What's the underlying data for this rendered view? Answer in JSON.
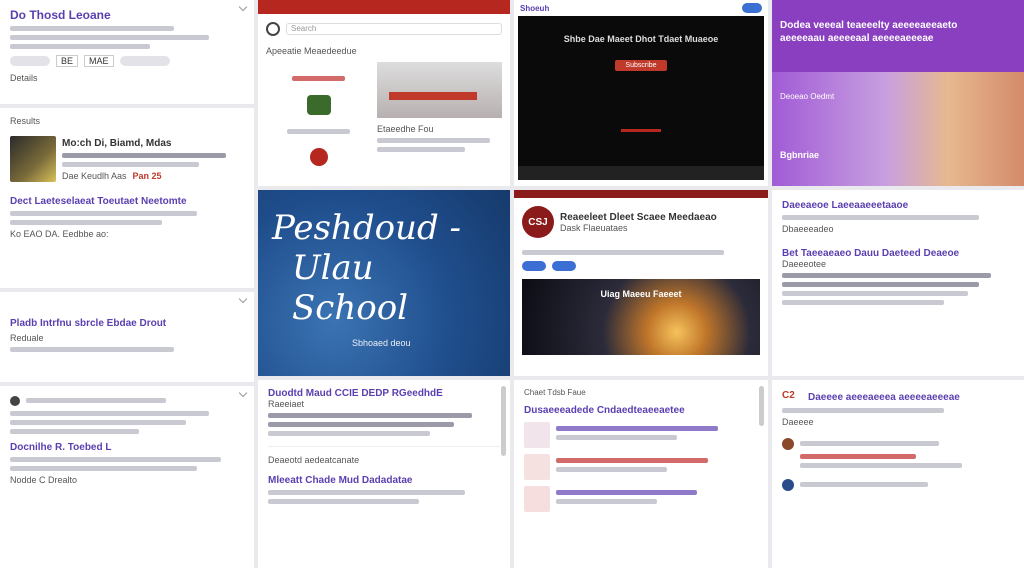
{
  "col1": {
    "header": "Do Thosd Leoane",
    "tags": [
      "BE",
      "MAE"
    ],
    "more_label": "Details",
    "feed_label": "Results",
    "item_title": "Mo:ch Di, Biamd, Mdas",
    "item_sub": "Dae Keudlh Aas",
    "item_meta": "Pan 25",
    "section_title": "Dect Laeteselaeat Toeutaet Neetomte",
    "section_meta": "Ko EAO DA. Eedbbe ao:",
    "section2_title": "Pladb Intrfnu sbrcle Ebdae Drout",
    "section2_sub": "Reduale",
    "section3_title": "Docnilhe R. Toebed L",
    "section3_meta": "Nodde C Drealto"
  },
  "col2": {
    "search_placeholder": "Search",
    "feed_title": "Apeeatie Meaedeedue",
    "card_caption": "Etaeedhe Fou",
    "hero_line1": "Peshdoud -",
    "hero_line2": "Ulau School",
    "hero_sub": "Sbhoaed deou",
    "card2_title": "Duodtd Maud CCIE DEDP RGeedhdE",
    "card2_sub": "Raeeiaet",
    "card3_header": "Deaeotd aedeatcanate",
    "card3_title": "Mleeatt Chade Mud Dadadatae"
  },
  "col3": {
    "tab_label": "Shoeuh",
    "banner_title": "Shbe Dae Maeet Dhot Tdaet Muaeoe",
    "banner_cta": "Subscribe",
    "promo_badge": "CSJ",
    "promo_title": "Reaeeleet Dleet Scaee Meedaeao",
    "promo_sub": "Dask Flaeuataes",
    "sky_caption": "Uiag Maeeu Faeeet",
    "list_header": "Chaet Tdsb Faue",
    "list_title": "Dusaeeeadede Cndaedteaeeaetee"
  },
  "col4": {
    "banner_line1": "Dodea veeeal teaeeelty aeeeeaeeaeto",
    "banner_line2": "aeeeeaau aeeeeaal aeeeeaeeeae",
    "banner_side": "Deoeao Oedmt",
    "banner_footer": "Bgbnriae",
    "card_title": "Daeeaeoe Laeeaaeeetaaoe",
    "card_sub": "Dbaeeeadeo",
    "section_title": "Bet Taeeaeaeo Dauu Daeteed Deaeoe",
    "section_sub": "Daeeeotee",
    "comment_badge": "C2",
    "comment_title": "Daeeee aeeeaeeea aeeeeaeeeae",
    "comment_meta": "Daeeee"
  },
  "colors": {
    "purple": "#8a3fc0",
    "red_bar": "#b5271f",
    "hero_blue": "#1f4d8c",
    "dark_panel": "#0a0a0a"
  }
}
